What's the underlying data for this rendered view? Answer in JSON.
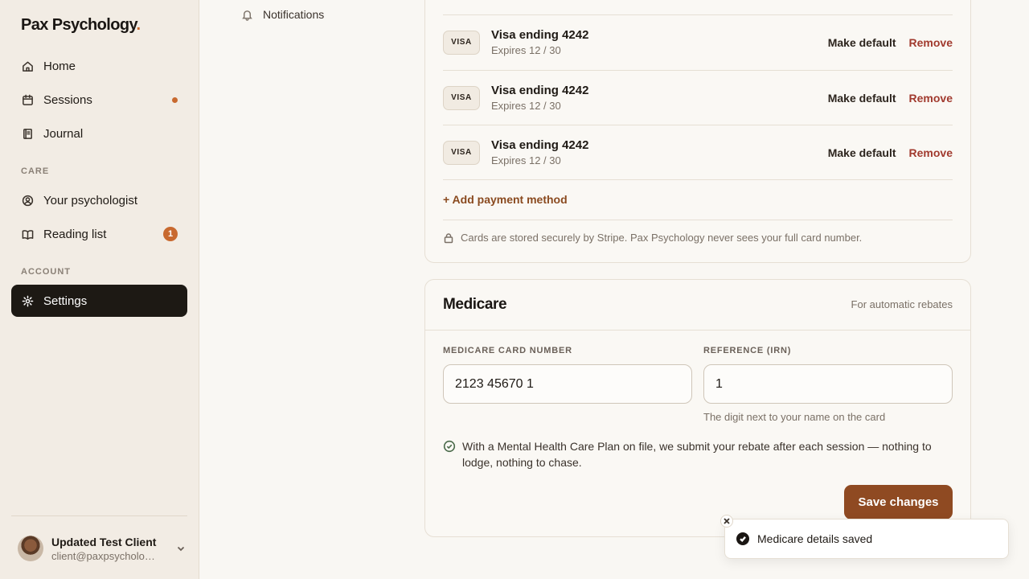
{
  "brand": {
    "name": "Pax Psychology",
    "dot": ".",
    "accent": "#c8692f"
  },
  "sidebar": {
    "nav": [
      {
        "label": "Home",
        "icon": "home-icon"
      },
      {
        "label": "Sessions",
        "icon": "calendar-icon",
        "indicator": "dot"
      },
      {
        "label": "Journal",
        "icon": "journal-icon"
      }
    ],
    "care_label": "CARE",
    "care": [
      {
        "label": "Your psychologist",
        "icon": "user-circle-icon"
      },
      {
        "label": "Reading list",
        "icon": "book-icon",
        "badge": "1"
      }
    ],
    "account_label": "ACCOUNT",
    "account": [
      {
        "label": "Settings",
        "icon": "gear-icon",
        "active": true
      }
    ],
    "user": {
      "name": "Updated Test Client",
      "email": "client@paxpsychology.com.au"
    }
  },
  "subnav": {
    "notifications": "Notifications"
  },
  "payment": {
    "cards": [
      {
        "title": "Visa ending 4242",
        "expiry": "Expires 12 / 30",
        "brand": "VISA",
        "make_default": "Make default",
        "remove": "Remove"
      },
      {
        "title": "Visa ending 4242",
        "expiry": "Expires 12 / 30",
        "brand": "VISA",
        "make_default": "Make default",
        "remove": "Remove"
      },
      {
        "title": "Visa ending 4242",
        "expiry": "Expires 12 / 30",
        "brand": "VISA",
        "make_default": "Make default",
        "remove": "Remove"
      }
    ],
    "add_label": "+ Add payment method",
    "secure_note": "Cards are stored securely by Stripe. Pax Psychology never sees your full card number."
  },
  "medicare": {
    "title": "Medicare",
    "hint": "For automatic rebates",
    "card_label": "MEDICARE CARD NUMBER",
    "card_value": "2123 45670 1",
    "irn_label": "REFERENCE (IRN)",
    "irn_value": "1",
    "irn_help": "The digit next to your name on the card",
    "plan_note": "With a Mental Health Care Plan on file, we submit your rebate after each session — nothing to lodge, nothing to chase.",
    "save_label": "Save changes",
    "save_color": "#8f4a22"
  },
  "toast": {
    "message": "Medicare details saved"
  }
}
